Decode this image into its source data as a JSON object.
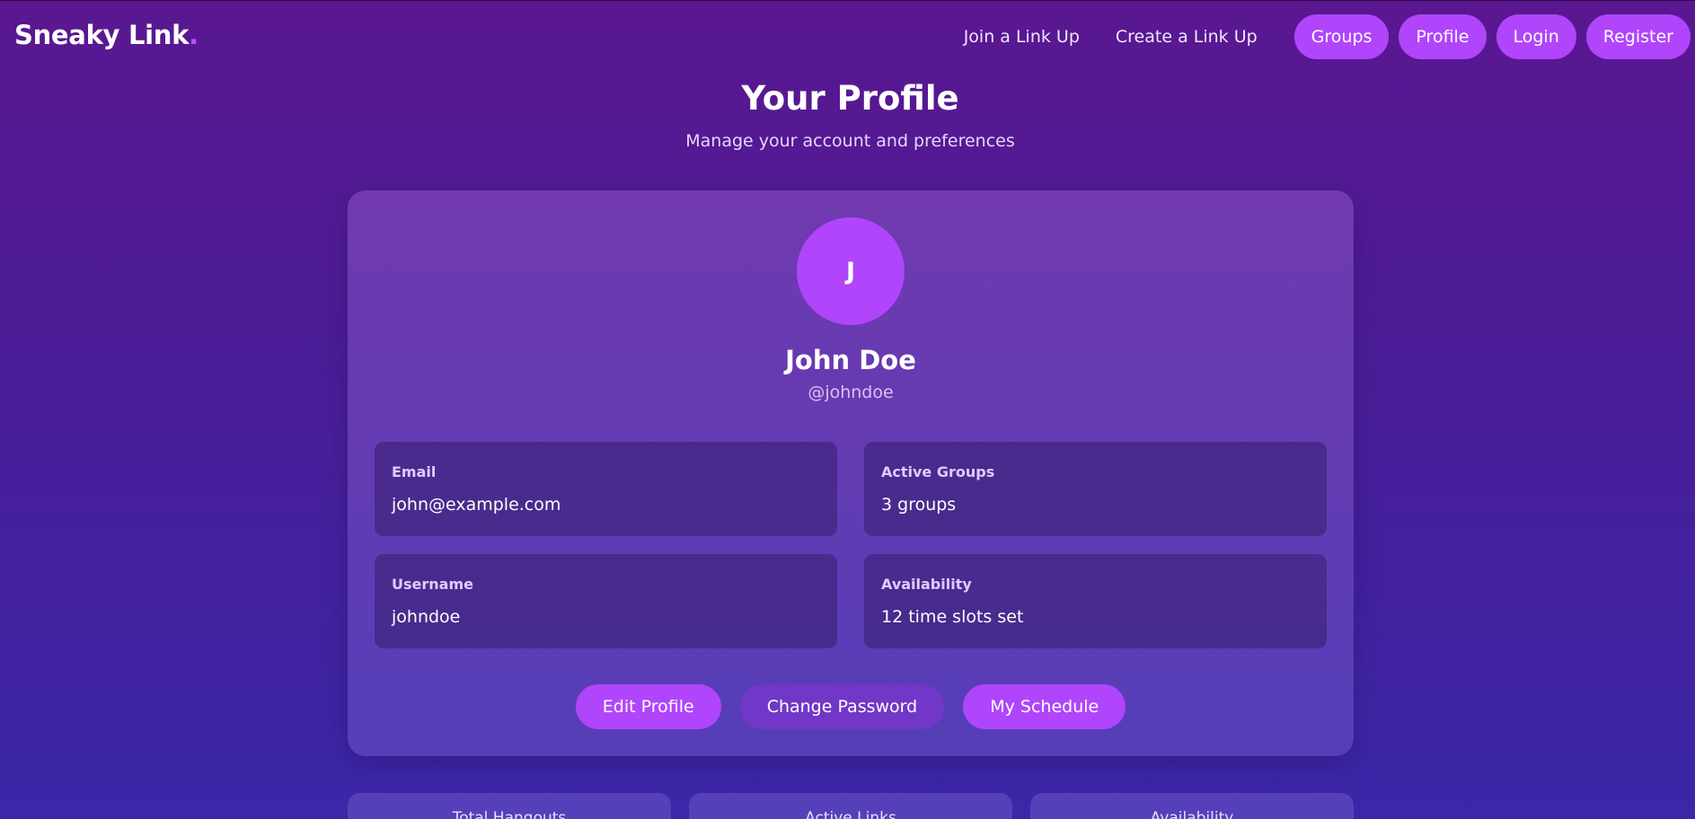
{
  "brand": {
    "name": "Sneaky Link",
    "dot": "."
  },
  "nav": {
    "links": [
      "Join a Link Up",
      "Create a Link Up"
    ],
    "pills": [
      "Groups",
      "Profile",
      "Login",
      "Register"
    ]
  },
  "header": {
    "title": "Your Profile",
    "subtitle": "Manage your account and preferences"
  },
  "profile": {
    "avatar_initial": "J",
    "name": "John Doe",
    "handle": "@johndoe",
    "fields": {
      "email": {
        "label": "Email",
        "value": "john@example.com"
      },
      "groups": {
        "label": "Active Groups",
        "value": "3 groups"
      },
      "username": {
        "label": "Username",
        "value": "johndoe"
      },
      "availability": {
        "label": "Availability",
        "value": "12 time slots set"
      }
    },
    "actions": {
      "edit": "Edit Profile",
      "password": "Change Password",
      "schedule": "My Schedule"
    }
  },
  "stats": [
    "Total Hangouts",
    "Active Links",
    "Availability"
  ],
  "colors": {
    "accent": "#b045fb",
    "secondary_button": "#7137c8",
    "background_top": "#5a1790",
    "background_bottom": "#3b27a8"
  }
}
